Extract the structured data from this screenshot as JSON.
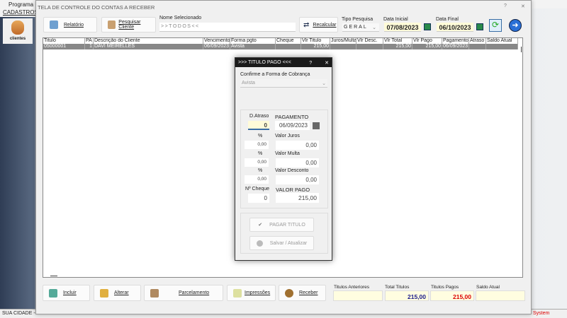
{
  "app": {
    "title": "Programa",
    "menu": "CADASTROS",
    "clientes": "clientes",
    "status_left": "SUA CIDADE -",
    "status_right": "System"
  },
  "window": {
    "title": "TELA DE CONTROLE DO CONTAS A RECEBER",
    "help": "?",
    "close": "✕"
  },
  "toolbar": {
    "relatorio": "Relatório",
    "pesquisar": "Pesquisar Cliente",
    "nome_label": "Nome Selecionado",
    "nome_value": ">>TODOS<<",
    "recalcular": "Recalcular",
    "tipo_label": "Tipo  Pesquisa",
    "tipo_value": "GERAL",
    "data_ini_label": "Data Inicial",
    "data_ini": "07/08/2023",
    "data_fim_label": "Data Final",
    "data_fim": "06/10/2023"
  },
  "grid": {
    "headers": [
      "Titulo",
      "PA",
      "Descrição do Cliente",
      "Vencimento",
      "Forma pgto",
      "Cheque",
      "Vlr Titulo",
      "Juros/Multa",
      "Vlr Desc.",
      "Vlr Total",
      "Vlr Pago",
      "Pagamento",
      "Atraso",
      "Saldo Atual"
    ],
    "rows": [
      [
        "05000001",
        "1",
        "DAVI MEIRELLES",
        "06/09/2023",
        "Avista",
        "",
        "215,00",
        "",
        "",
        "215,00",
        "215,00",
        "06/09/2023",
        "",
        ""
      ]
    ]
  },
  "dialog": {
    "title": ">>> TITULO PAGO <<<",
    "help": "?",
    "close": "✕",
    "confirm_label": "Confirme a Forma de Cobrança",
    "forma": "Avista",
    "d_atraso_label": "D.Atraso",
    "d_atraso": "0",
    "pagamento_label": "PAGAMENTO",
    "pagamento": "06/09/2023",
    "pct": "%",
    "juros_pct": "0,00",
    "juros_label": "Valor Juros",
    "juros": "0,00",
    "multa_pct": "0,00",
    "multa_label": "Valor Multa",
    "multa": "0,00",
    "desc_pct": "0,00",
    "desc_label": "Valor Desconto",
    "desconto": "0,00",
    "cheque_label": "Nº Cheque",
    "cheque": "0",
    "valor_pago_label": "VALOR PAGO",
    "valor_pago": "215,00",
    "pagar": "PAGAR TITULO",
    "salvar": "Salvar / Atualizar"
  },
  "bottom": {
    "incluir": "Incluir",
    "alterar": "Alterar",
    "parcelamento": "Parcelamento",
    "impressoes": "Impressões",
    "receber": "Receber",
    "tit_ant_label": "Titulos Anteriores",
    "tit_ant": "",
    "total_label": "Total Titulos",
    "total": "215,00",
    "pagos_label": "Titulos Pagos",
    "pagos": "215,00",
    "saldo_label": "Saldo Atual",
    "saldo": ""
  }
}
